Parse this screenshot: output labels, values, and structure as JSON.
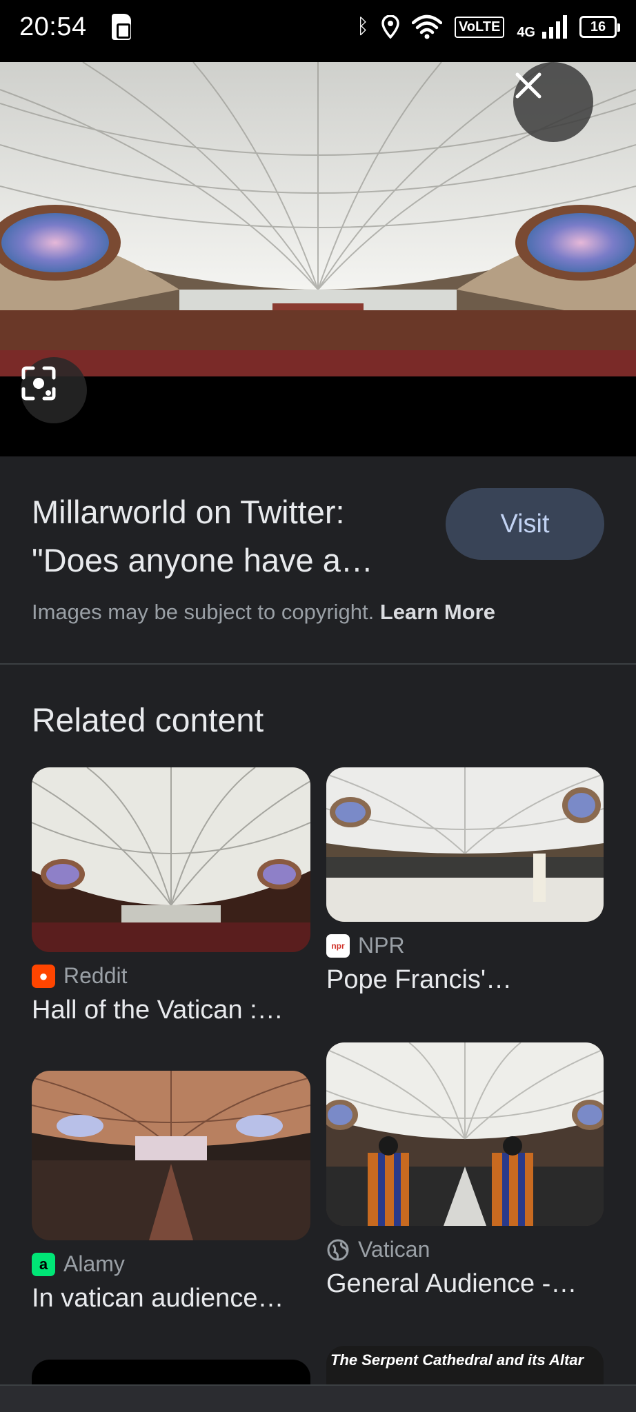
{
  "status_bar": {
    "time": "20:54",
    "network": "4G",
    "volte": "VoLTE",
    "battery": "16",
    "icons": [
      "sim-card-icon",
      "bluetooth-icon",
      "location-icon",
      "wifi-icon",
      "signal-icon",
      "battery-icon"
    ]
  },
  "viewer": {
    "close_icon": "close-icon",
    "lens_icon": "google-lens-icon"
  },
  "info": {
    "title": "Millarworld on Twitter: \"Does anyone have a…",
    "visit_label": "Visit",
    "copyright_text": "Images may be subject to copyright.",
    "learn_more": "Learn More"
  },
  "related": {
    "heading": "Related content",
    "items": [
      {
        "source": "Reddit",
        "title": "Hall of the Vatican :…",
        "icon": "reddit-icon",
        "icon_color": "#ff4500"
      },
      {
        "source": "NPR",
        "title": "Pope Francis'…",
        "icon": "npr-icon",
        "icon_color": "#ffffff"
      },
      {
        "source": "Alamy",
        "title": "In vatican audience…",
        "icon": "alamy-icon",
        "icon_color": "#00e676"
      },
      {
        "source": "Vatican",
        "title": "General Audience -…",
        "icon": "globe-icon",
        "icon_color": "#9aa0a6"
      },
      {
        "source": "",
        "title": "",
        "overlay_text": "The Serpent Cathedral and its Altar"
      }
    ]
  },
  "colors": {
    "background": "#202124",
    "visit_button": "#394457",
    "visit_text": "#c2d3f3"
  }
}
